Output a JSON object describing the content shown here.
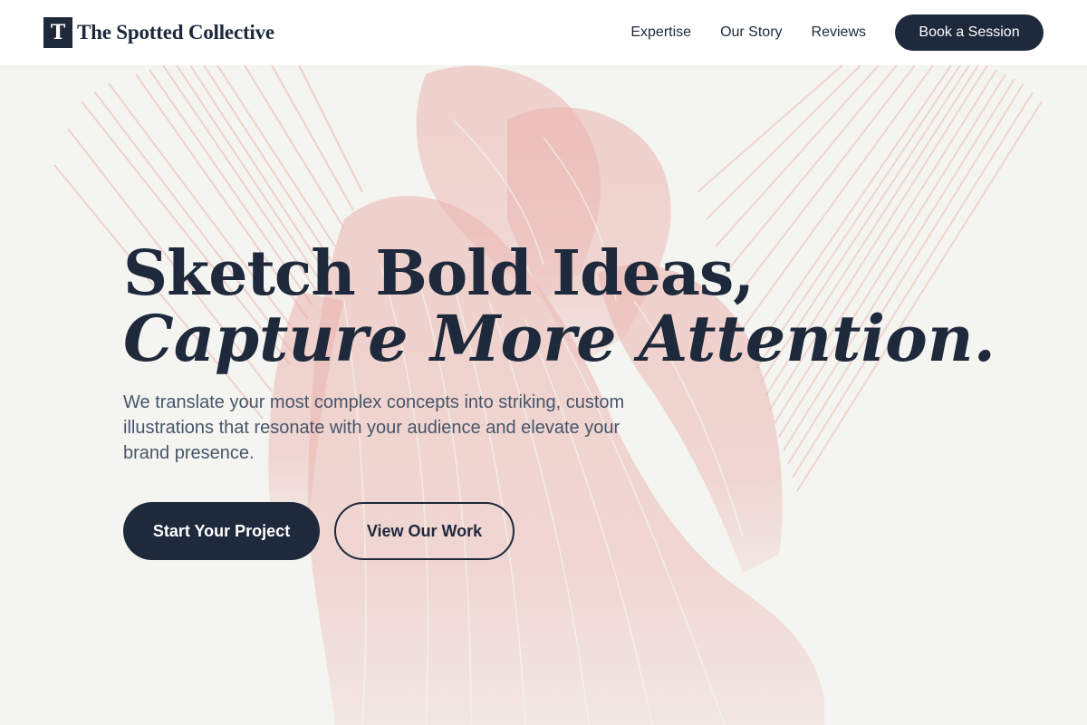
{
  "brand": {
    "logo_letter": "T",
    "name": "The Spotted Collective"
  },
  "nav": {
    "links": [
      "Expertise",
      "Our Story",
      "Reviews"
    ],
    "cta_label": "Book a Session"
  },
  "hero": {
    "headline_line1": "Sketch Bold Ideas,",
    "headline_line2": "Capture More Attention.",
    "subtext": "We translate your most complex concepts into striking, custom illustrations that resonate with your audience and elevate your brand presence.",
    "primary_button": "Start Your Project",
    "secondary_button": "View Our Work",
    "background_art": "pink engraving-style illustration of winged figures"
  },
  "colors": {
    "navy": "#1e293b",
    "slate_text": "#475569",
    "hero_bg": "#f4f5f1",
    "art_pink": "#eab1ad",
    "header_bg": "#ffffff"
  }
}
